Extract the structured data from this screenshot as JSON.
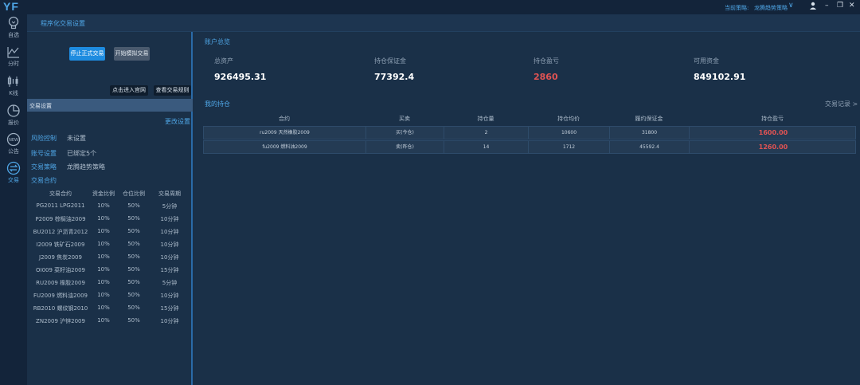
{
  "app": {
    "logo": "YF"
  },
  "topbar": {
    "strategy_label": "当前策略:",
    "strategy_value": "龙腾趋势策略"
  },
  "nav": [
    {
      "label": "自选",
      "icon": "bulb-icon"
    },
    {
      "label": "分时",
      "icon": "line-chart-icon"
    },
    {
      "label": "K线",
      "icon": "candlestick-icon"
    },
    {
      "label": "报价",
      "icon": "pie-chart-icon"
    },
    {
      "label": "公告",
      "icon": "new-badge-icon"
    },
    {
      "label": "交易",
      "icon": "exchange-icon"
    }
  ],
  "header": {
    "tab": "程序化交易设置"
  },
  "left": {
    "stop_button": "停止正式交易",
    "start_sim_button": "开始模拟交易",
    "official_site_button": "点击进入官网",
    "rules_button": "查看交易规则",
    "section_title": "交易设置",
    "change_link": "更改设置",
    "settings": [
      {
        "key": "风险控制",
        "value": "未设置"
      },
      {
        "key": "账号设置",
        "value": "已绑定5个"
      },
      {
        "key": "交易策略",
        "value": "龙腾趋势策略"
      }
    ],
    "contracts_title": "交易合约",
    "contract_headers": [
      "交易合约",
      "资金比例",
      "仓位比例",
      "交易周期"
    ],
    "contracts": [
      [
        "PG2011 LPG2011",
        "10%",
        "50%",
        "5分钟"
      ],
      [
        "P2009 棕榈油2009",
        "10%",
        "50%",
        "10分钟"
      ],
      [
        "BU2012 沪沥青2012",
        "10%",
        "50%",
        "10分钟"
      ],
      [
        "I2009 铁矿石2009",
        "10%",
        "50%",
        "10分钟"
      ],
      [
        "J2009 焦炭2009",
        "10%",
        "50%",
        "10分钟"
      ],
      [
        "OI009 菜籽油2009",
        "10%",
        "50%",
        "15分钟"
      ],
      [
        "RU2009 橡胶2009",
        "10%",
        "50%",
        "5分钟"
      ],
      [
        "FU2009 燃料油2009",
        "10%",
        "50%",
        "10分钟"
      ],
      [
        "RB2010 螺纹钢2010",
        "10%",
        "50%",
        "15分钟"
      ],
      [
        "ZN2009 沪锌2009",
        "10%",
        "50%",
        "10分钟"
      ]
    ]
  },
  "account": {
    "title": "账户总览",
    "stats": [
      {
        "label": "总资产",
        "value": "926495.31",
        "color": "#ffffff"
      },
      {
        "label": "持仓保证金",
        "value": "77392.4",
        "color": "#ffffff"
      },
      {
        "label": "持仓盈亏",
        "value": "2860",
        "color": "#e05353"
      },
      {
        "label": "可用资金",
        "value": "849102.91",
        "color": "#ffffff"
      }
    ]
  },
  "holdings": {
    "title": "我的持仓",
    "record_link": "交易记录 >",
    "headers": [
      "合约",
      "买卖",
      "持仓量",
      "持仓均价",
      "履约保证金",
      "持仓盈亏"
    ],
    "rows": [
      [
        "ru2009 天然橡胶2009",
        "买(今仓)",
        "2",
        "10600",
        "31800",
        "1600.00"
      ],
      [
        "fu2009 燃料油2009",
        "卖(昨仓)",
        "14",
        "1712",
        "45592.4",
        "1260.00"
      ]
    ]
  }
}
